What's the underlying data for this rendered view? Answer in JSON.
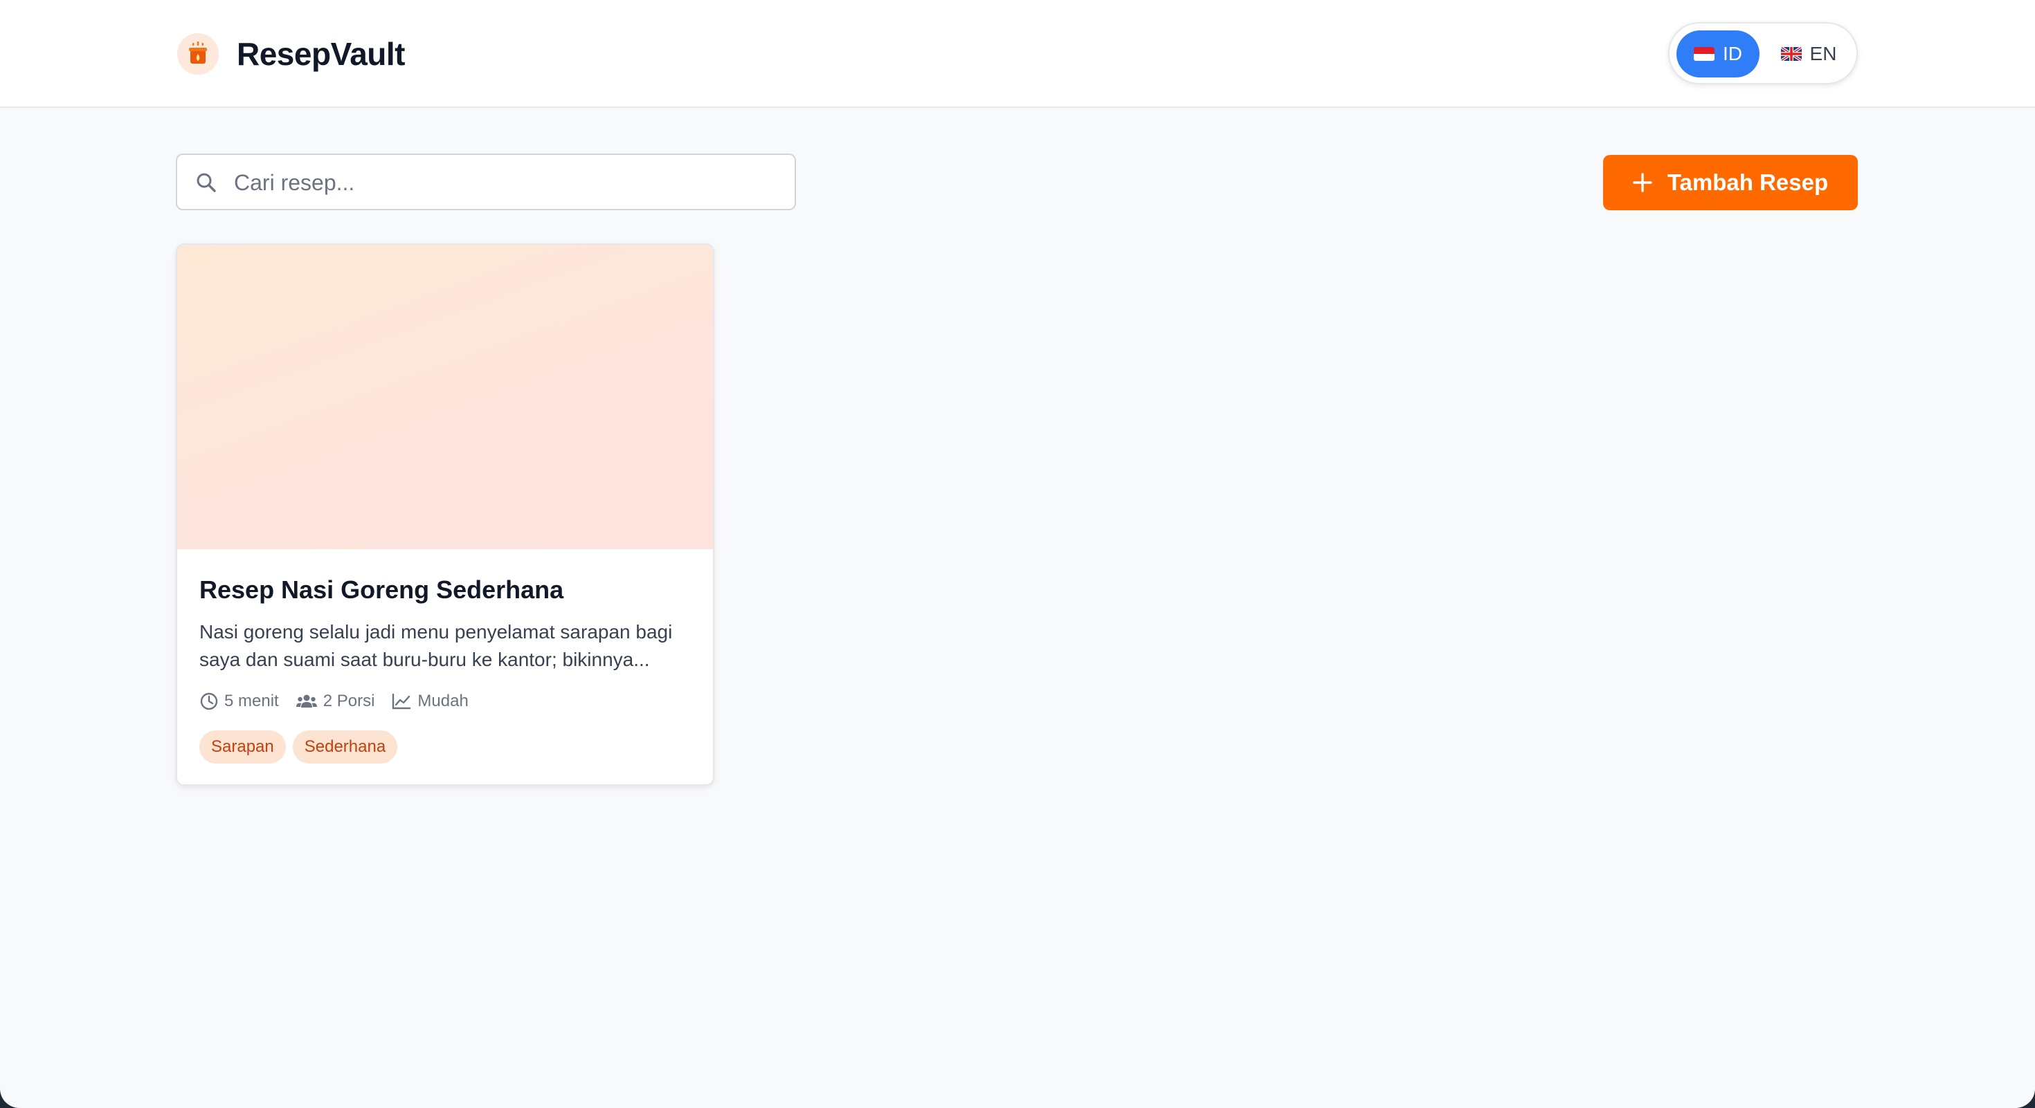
{
  "app": {
    "name": "ResepVault",
    "logo_icon": "cooking-pot-icon"
  },
  "language": {
    "options": [
      {
        "code": "ID",
        "flag": "indonesia-flag-icon",
        "active": true
      },
      {
        "code": "EN",
        "flag": "uk-flag-icon",
        "active": false
      }
    ]
  },
  "search": {
    "placeholder": "Cari resep...",
    "value": "",
    "icon": "search-icon"
  },
  "toolbar": {
    "add_label": "Tambah Resep",
    "add_icon": "plus-icon"
  },
  "recipes": [
    {
      "title": "Resep Nasi Goreng Sederhana",
      "description": "Nasi goreng selalu jadi menu penyelamat sarapan bagi saya dan suami saat buru-buru ke kantor; bikinnya...",
      "time": "5 menit",
      "servings": "2 Porsi",
      "difficulty": "Mudah",
      "tags": [
        "Sarapan",
        "Sederhana"
      ]
    }
  ],
  "colors": {
    "accent": "#ff6a00",
    "active_toggle": "#2f7ef7",
    "tag_bg": "#fde3d2",
    "tag_text": "#c2410c"
  }
}
